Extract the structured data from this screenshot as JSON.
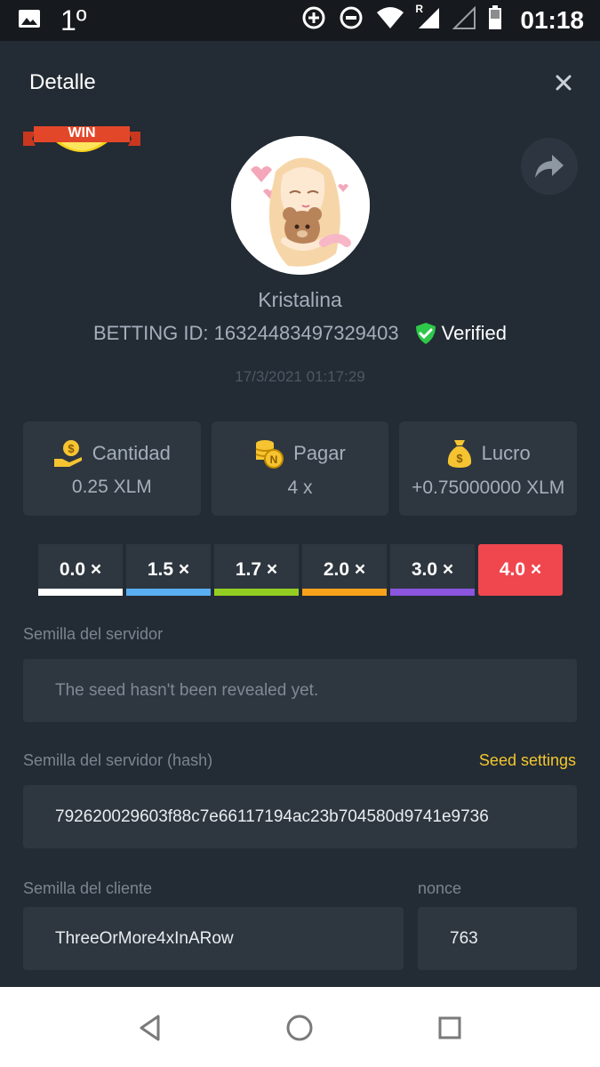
{
  "status_bar": {
    "notification_count": "1º",
    "clock": "01:18",
    "signal_label": "R"
  },
  "header": {
    "title": "Detalle",
    "win_badge": "WIN"
  },
  "profile": {
    "username": "Kristalina",
    "betting_id": "BETTING ID: 16324483497329403",
    "verified_label": "Verified",
    "timestamp": "17/3/2021 01:17:29"
  },
  "stats": [
    {
      "label": "Cantidad",
      "value": "0.25 XLM",
      "icon": "hand-coin-icon"
    },
    {
      "label": "Pagar",
      "value": "4 x",
      "icon": "coin-stack-icon"
    },
    {
      "label": "Lucro",
      "value": "+0.75000000 XLM",
      "icon": "money-bag-icon"
    }
  ],
  "multipliers": [
    {
      "label": "0.0 ×",
      "color": "#ffffff",
      "active": false
    },
    {
      "label": "1.5 ×",
      "color": "#5aaef2",
      "active": false
    },
    {
      "label": "1.7 ×",
      "color": "#93cf22",
      "active": false
    },
    {
      "label": "2.0 ×",
      "color": "#f7a21b",
      "active": false
    },
    {
      "label": "3.0 ×",
      "color": "#8b55de",
      "active": false
    },
    {
      "label": "4.0 ×",
      "color": "#f0474f",
      "active": true
    }
  ],
  "server_seed": {
    "label": "Semilla del servidor",
    "value": "The seed hasn't been revealed yet."
  },
  "server_hash": {
    "label": "Semilla del servidor (hash)",
    "link": "Seed settings",
    "value": "792620029603f88c7e66117194ac23b704580d9741e9736"
  },
  "client_seed": {
    "label": "Semilla del cliente",
    "value": "ThreeOrMore4xInARow"
  },
  "nonce": {
    "label": "nonce",
    "value": "763"
  },
  "colors": {
    "accent_yellow": "#f3c72e",
    "verified_green": "#2ec84a",
    "active_red": "#f0474f"
  }
}
